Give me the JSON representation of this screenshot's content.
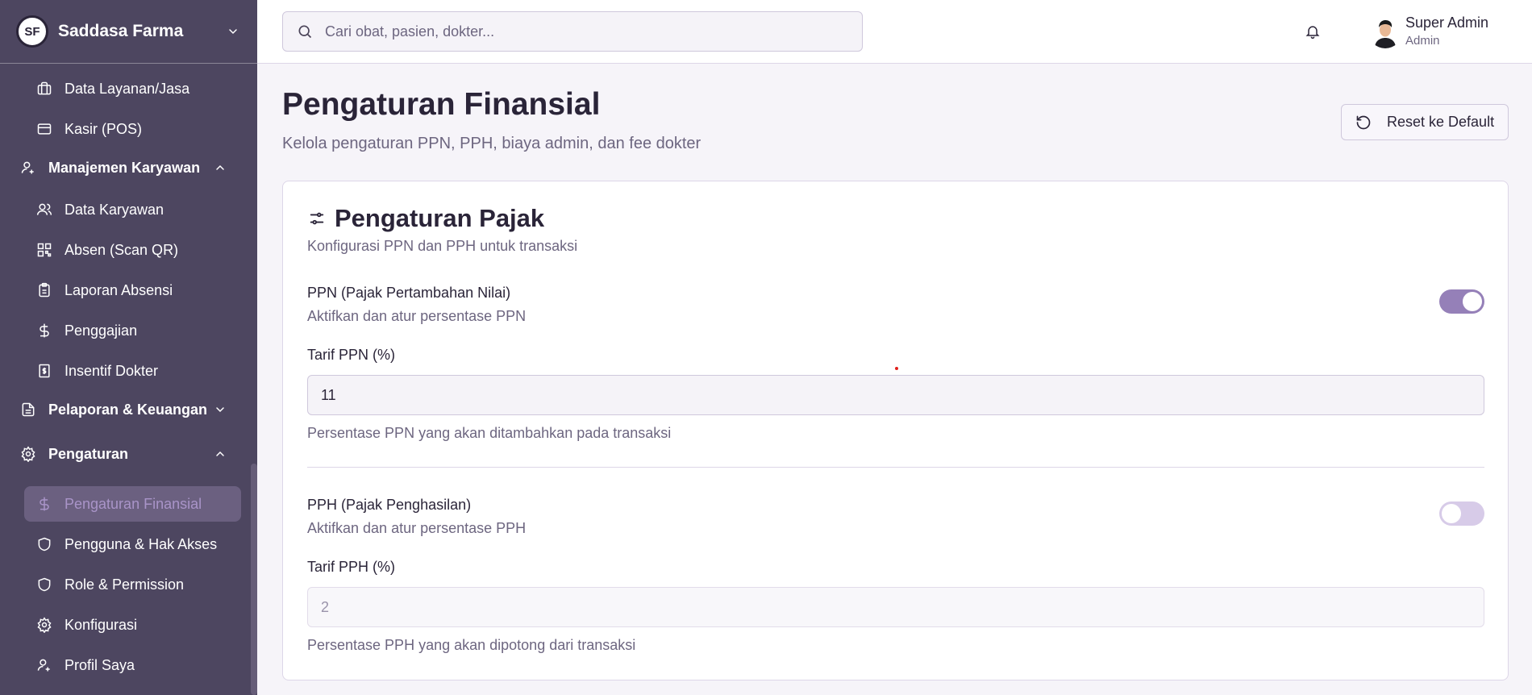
{
  "brand": {
    "name": "Saddasa Farma",
    "logo_text": "SF"
  },
  "sidebar": {
    "items": [
      {
        "label": "Data Layanan/Jasa",
        "icon": "briefcase-icon"
      },
      {
        "label": "Kasir (POS)",
        "icon": "credit-card-icon"
      },
      {
        "label": "Manajemen Karyawan",
        "icon": "user-cog-icon",
        "group": true,
        "expanded": true
      },
      {
        "label": "Data Karyawan",
        "icon": "users-icon"
      },
      {
        "label": "Absen (Scan QR)",
        "icon": "qr-code-icon"
      },
      {
        "label": "Laporan Absensi",
        "icon": "clipboard-icon"
      },
      {
        "label": "Penggajian",
        "icon": "dollar-icon"
      },
      {
        "label": "Insentif Dokter",
        "icon": "receipt-dollar-icon"
      },
      {
        "label": "Pelaporan & Keuangan",
        "icon": "file-text-icon",
        "group": true,
        "expanded": false
      },
      {
        "label": "Pengaturan",
        "icon": "gear-icon",
        "group": true,
        "expanded": true
      },
      {
        "label": "Pengaturan Finansial",
        "icon": "dollar-icon",
        "active": true
      },
      {
        "label": "Pengguna & Hak Akses",
        "icon": "shield-icon"
      },
      {
        "label": "Role & Permission",
        "icon": "shield-icon"
      },
      {
        "label": "Konfigurasi",
        "icon": "gear-icon"
      },
      {
        "label": "Profil Saya",
        "icon": "user-cog-icon"
      }
    ]
  },
  "topbar": {
    "search_placeholder": "Cari obat, pasien, dokter...",
    "user_name": "Super Admin",
    "user_role": "Admin"
  },
  "page": {
    "title": "Pengaturan Finansial",
    "subtitle": "Kelola pengaturan PPN, PPH, biaya admin, dan fee dokter",
    "reset_label": "Reset ke Default"
  },
  "tax_card": {
    "title": "Pengaturan Pajak",
    "subtitle": "Konfigurasi PPN dan PPH untuk transaksi",
    "ppn": {
      "title": "PPN (Pajak Pertambahan Nilai)",
      "desc": "Aktifkan dan atur persentase PPN",
      "enabled": true,
      "rate_label": "Tarif PPN (%)",
      "rate_value": "11",
      "help": "Persentase PPN yang akan ditambahkan pada transaksi"
    },
    "pph": {
      "title": "PPH (Pajak Penghasilan)",
      "desc": "Aktifkan dan atur persentase PPH",
      "enabled": false,
      "rate_label": "Tarif PPH (%)",
      "rate_value": "2",
      "help": "Persentase PPH yang akan dipotong dari transaksi"
    }
  },
  "colors": {
    "sidebar_bg": "#4d4660",
    "accent": "#9580b8",
    "active_text": "#a994c8",
    "toggle_off": "#d7cbe8"
  }
}
